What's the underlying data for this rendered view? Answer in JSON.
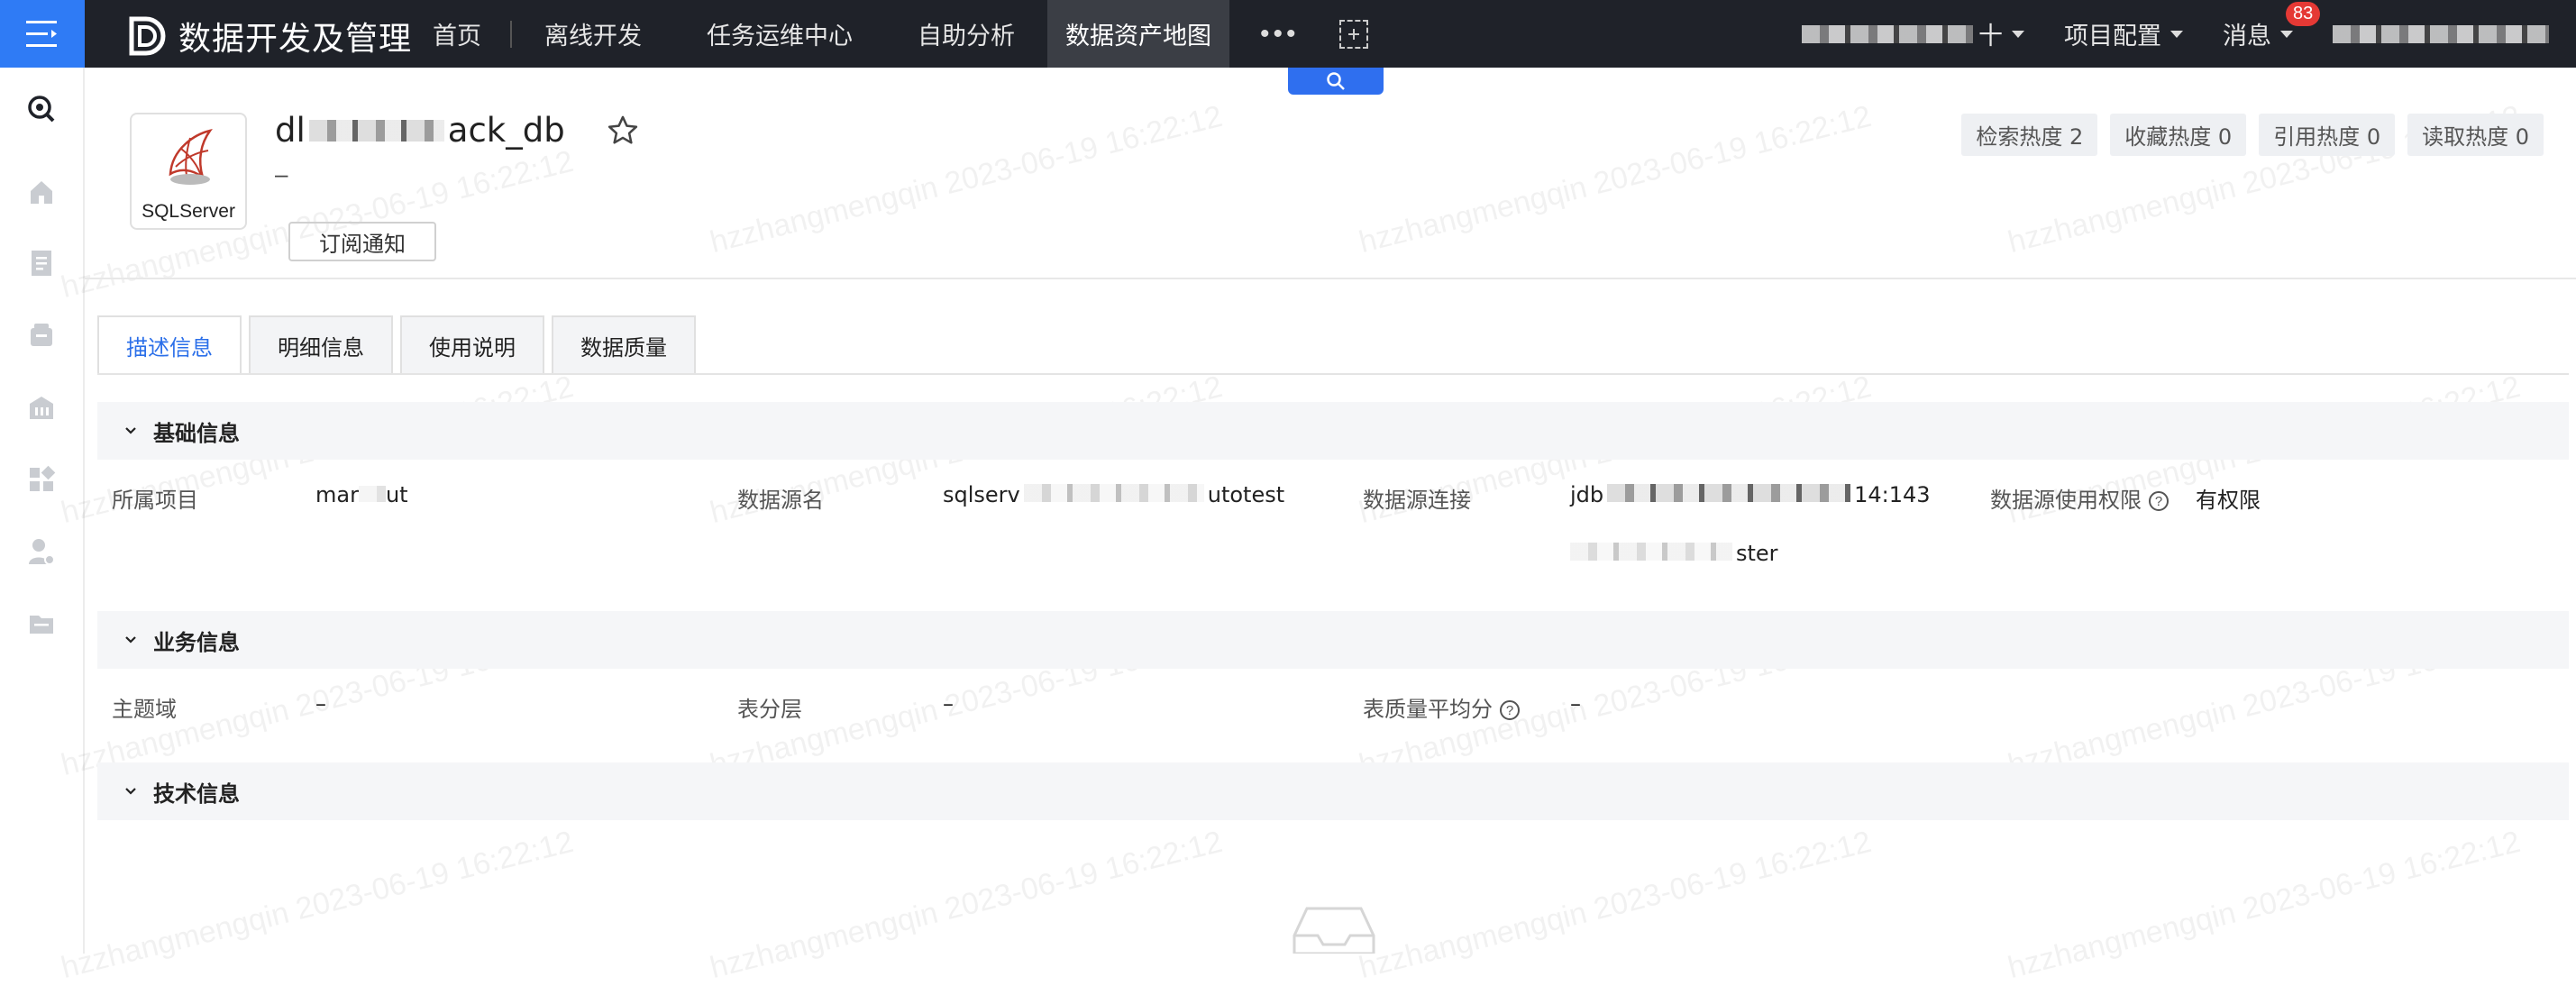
{
  "app": {
    "title": "数据开发及管理"
  },
  "nav": {
    "items": [
      "首页",
      "离线开发",
      "任务运维中心",
      "自助分析",
      "数据资产地图"
    ],
    "active_index": 4,
    "more": "•••"
  },
  "header_right": {
    "project_suffix": "十",
    "project_config": "项目配置",
    "messages": "消息",
    "message_count": "83"
  },
  "asset": {
    "type_label": "SQLServer",
    "name_visible_start": "dl",
    "name_visible_end": "ack_db",
    "description": "–",
    "subscribe_label": "订阅通知",
    "heat": [
      "检索热度 2",
      "收藏热度 0",
      "引用热度 0",
      "读取热度 0"
    ]
  },
  "tabs": [
    "描述信息",
    "明细信息",
    "使用说明",
    "数据质量"
  ],
  "active_tab": 0,
  "sections": {
    "basic": {
      "title": "基础信息",
      "project_label": "所属项目",
      "project_value_start": "mar",
      "project_value_end": "ut",
      "source_name_label": "数据源名",
      "source_name_start": "sqlserv",
      "source_name_end": "utotest",
      "conn_label": "数据源连接",
      "conn_start": "jdb",
      "conn_end": "14:143",
      "conn_line2_end": "ster",
      "perm_label": "数据源使用权限",
      "perm_value": "有权限"
    },
    "business": {
      "title": "业务信息",
      "domain_label": "主题域",
      "domain_value": "–",
      "layer_label": "表分层",
      "layer_value": "–",
      "quality_label": "表质量平均分",
      "quality_value": "–"
    },
    "tech": {
      "title": "技术信息"
    }
  },
  "watermark": "hzzhangmengqin 2023-06-19 16:22:12",
  "colors": {
    "accent": "#2f7bf5",
    "topbar": "#1f2229",
    "badge": "#e53935"
  }
}
